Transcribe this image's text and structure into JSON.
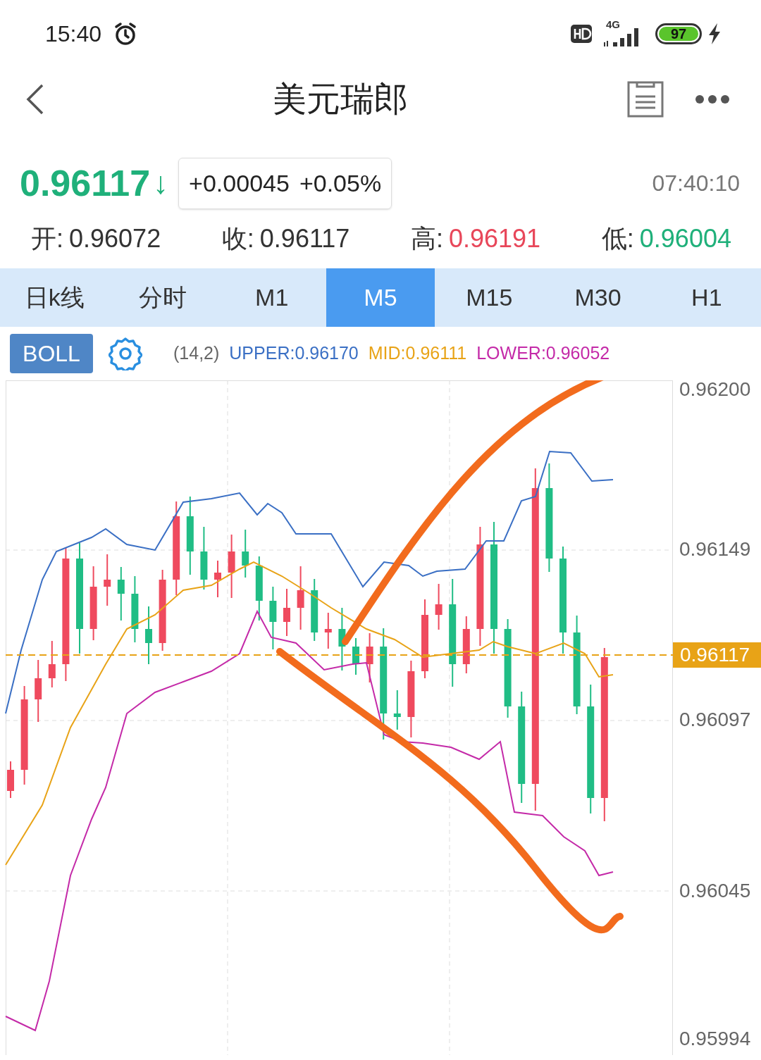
{
  "status_bar": {
    "time": "15:40",
    "network": "4G",
    "battery": "97"
  },
  "header": {
    "title": "美元瑞郎"
  },
  "quote": {
    "price": "0.96117",
    "arrow": "↓",
    "change": "+0.00045",
    "percent": "+0.05%",
    "time": "07:40:10"
  },
  "stats": [
    {
      "label": "开:",
      "value": "0.96072",
      "color": "#333333"
    },
    {
      "label": "收:",
      "value": "0.96117",
      "color": "#333333"
    },
    {
      "label": "高:",
      "value": "0.96191",
      "color": "#e8475a"
    },
    {
      "label": "低:",
      "value": "0.96004",
      "color": "#1fb07a"
    }
  ],
  "tabs": [
    {
      "label": "日k线",
      "selected": false
    },
    {
      "label": "分时",
      "selected": false
    },
    {
      "label": "M1",
      "selected": false
    },
    {
      "label": "M5",
      "selected": true
    },
    {
      "label": "M15",
      "selected": false
    },
    {
      "label": "M30",
      "selected": false
    },
    {
      "label": "H1",
      "selected": false
    }
  ],
  "indicator": {
    "name": "BOLL",
    "params": "(14,2)",
    "legend": [
      {
        "text": "UPPER:0.96170",
        "color": "#3a6fc4"
      },
      {
        "text": "MID:0.96111",
        "color": "#e8a317"
      },
      {
        "text": "LOWER:0.96052",
        "color": "#c42aa8"
      }
    ]
  },
  "chart": {
    "y_labels": [
      "0.96200",
      "0.96149",
      "0.96097",
      "0.96045",
      "0.95994"
    ],
    "current_price": "0.96117"
  }
}
